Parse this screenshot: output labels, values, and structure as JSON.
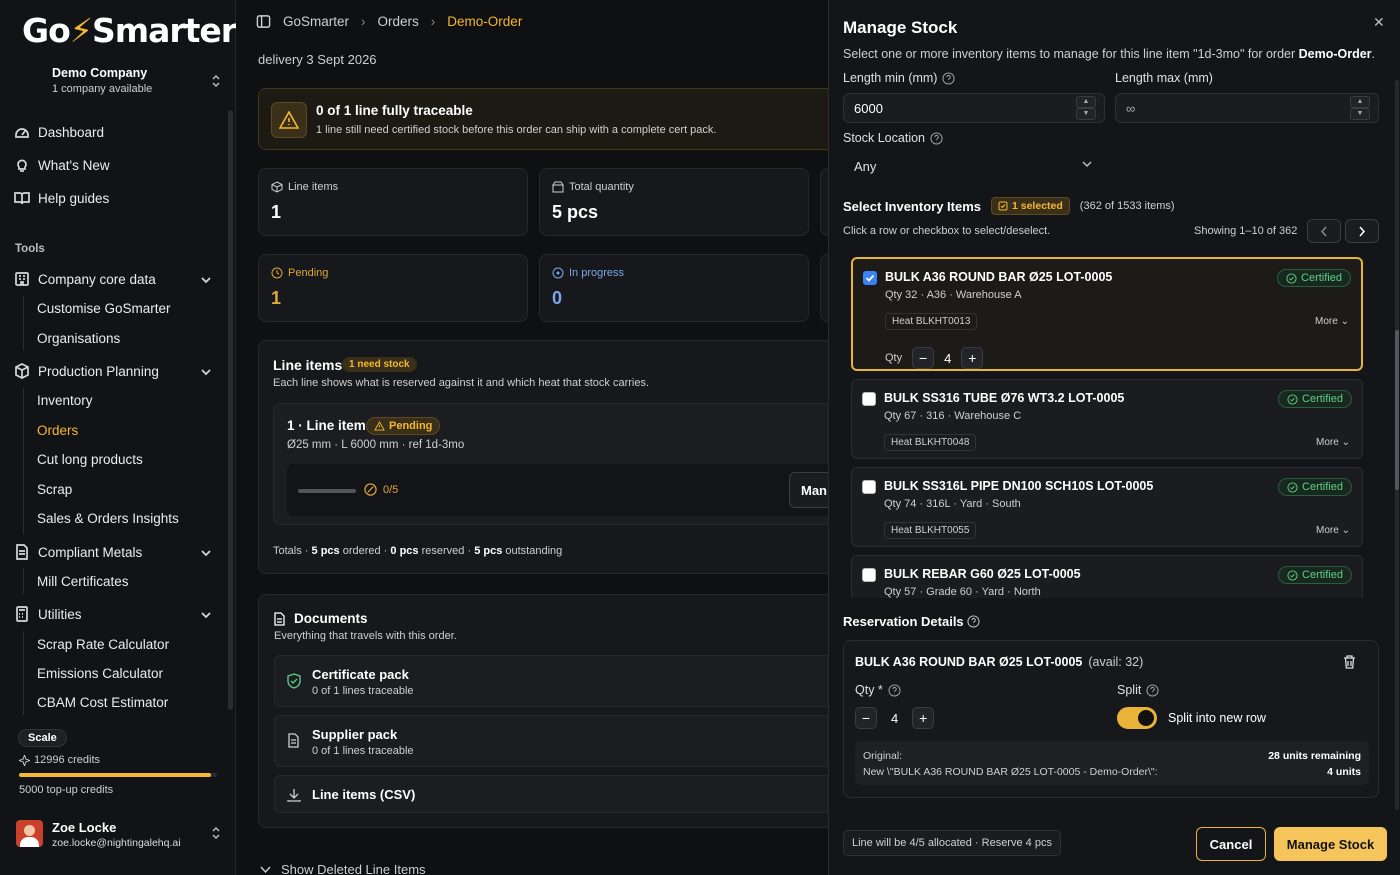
{
  "sidebar": {
    "logo": {
      "part1": "Go",
      "bolt": "⚡",
      "part2": "Smarter"
    },
    "company": {
      "name": "Demo Company",
      "sub": "1 company available"
    },
    "nav": [
      {
        "label": "Dashboard",
        "icon": "dashboard-icon"
      },
      {
        "label": "What's New",
        "icon": "lightbulb-icon"
      },
      {
        "label": "Help guides",
        "icon": "book-icon"
      }
    ],
    "tools_heading": "Tools",
    "groups": {
      "company": {
        "label": "Company core data",
        "items": [
          "Customise GoSmarter",
          "Organisations"
        ]
      },
      "production": {
        "label": "Production Planning",
        "items": [
          "Inventory",
          "Orders",
          "Cut long products",
          "Scrap",
          "Sales & Orders Insights"
        ]
      },
      "compliant": {
        "label": "Compliant Metals",
        "items": [
          "Mill Certificates"
        ]
      },
      "utilities": {
        "label": "Utilities",
        "items": [
          "Scrap Rate Calculator",
          "Emissions Calculator",
          "CBAM Cost Estimator"
        ]
      }
    },
    "active_item": "Orders",
    "plan": "Scale",
    "credits": "12996 credits",
    "credits_fraction": 0.97,
    "topup": "5000 top-up credits",
    "user": {
      "name": "Zoe Locke",
      "email": "zoe.locke@nightingalehq.ai"
    }
  },
  "main": {
    "breadcrumb": [
      "GoSmarter",
      "Orders",
      "Demo-Order"
    ],
    "delivery": "delivery 3 Sept 2026",
    "alert": {
      "title": "0 of 1 line fully traceable",
      "desc": "1 line still need certified stock before this order can ship with a complete cert pack."
    },
    "stats": {
      "line_items": {
        "label": "Line items",
        "value": "1"
      },
      "total_qty": {
        "label": "Total quantity",
        "value": "5 pcs"
      },
      "pending": {
        "label": "Pending",
        "value": "1"
      },
      "in_progress": {
        "label": "In progress",
        "value": "0"
      }
    },
    "line_items": {
      "title": "Line items",
      "badge": "1 need stock",
      "desc": "Each line shows what is reserved against it and which heat that stock carries.",
      "card": {
        "title": "1 · Line item",
        "status": "Pending",
        "meta": "Ø25 mm · L 6000 mm · ref 1d-3mo",
        "progress": "0/5",
        "manage_btn": "Man"
      },
      "totals": {
        "prefix": "Totals · ",
        "ordered_val": "5 pcs",
        "ordered_txt": " ordered · ",
        "reserved_val": "0 pcs",
        "reserved_txt": " reserved · ",
        "outstanding_val": "5 pcs",
        "outstanding_txt": " outstanding"
      }
    },
    "documents": {
      "title": "Documents",
      "desc": "Everything that travels with this order.",
      "items": [
        {
          "name": "Certificate pack",
          "sub": "0 of 1 lines traceable"
        },
        {
          "name": "Supplier pack",
          "sub": "0 of 1 lines traceable"
        },
        {
          "name": "Line items (CSV)",
          "sub": ""
        }
      ]
    },
    "show_deleted": "Show Deleted Line Items"
  },
  "panel": {
    "title": "Manage Stock",
    "close": "✕",
    "desc_prefix": "Select one or more inventory items to manage for this line item \"1d-3mo\" for order ",
    "desc_order": "Demo-Order",
    "desc_suffix": ".",
    "length_min": {
      "label": "Length min (mm)",
      "value": "6000"
    },
    "length_max": {
      "label": "Length max (mm)",
      "value": "∞"
    },
    "stock_location": {
      "label": "Stock Location",
      "value": "Any"
    },
    "select": {
      "title": "Select Inventory Items",
      "selected_badge": "1 selected",
      "count": "(362 of 1533 items)",
      "hint": "Click a row or checkbox to select/deselect.",
      "showing": "Showing 1–10 of 362"
    },
    "items": [
      {
        "name": "BULK A36 ROUND BAR Ø25 LOT-0005",
        "meta": "Qty 32 · A36 · Warehouse A",
        "cert": "Certified",
        "heat": "Heat BLKHT0013",
        "more": "More",
        "selected": true,
        "qty_label": "Qty",
        "qty": "4"
      },
      {
        "name": "BULK SS316 TUBE Ø76 WT3.2 LOT-0005",
        "meta": "Qty 67 · 316 · Warehouse C",
        "cert": "Certified",
        "heat": "Heat BLKHT0048",
        "more": "More",
        "selected": false
      },
      {
        "name": "BULK SS316L PIPE DN100 SCH10S LOT-0005",
        "meta": "Qty 74 · 316L · Yard · South",
        "cert": "Certified",
        "heat": "Heat BLKHT0055",
        "more": "More",
        "selected": false
      },
      {
        "name": "BULK REBAR G60 Ø25 LOT-0005",
        "meta": "Qty 57 · Grade 60 · Yard · North",
        "cert": "Certified",
        "heat": "",
        "more": "",
        "selected": false
      }
    ],
    "reservation": {
      "title": "Reservation Details",
      "item": "BULK A36 ROUND BAR Ø25 LOT-0005",
      "avail": "(avail: 32)",
      "qty_label": "Qty *",
      "qty": "4",
      "split_label": "Split",
      "split_toggle": "Split into new row",
      "split_on": true,
      "original_label": "Original:",
      "new_label": "New \\\"BULK A36 ROUND BAR Ø25 LOT-0005 - Demo-Order\\\":",
      "original_value": "28 units remaining",
      "new_value": "4 units"
    },
    "footer": {
      "note": "Line will be 4/5 allocated · Reserve 4 pcs",
      "cancel": "Cancel",
      "manage": "Manage Stock"
    }
  },
  "colors": {
    "accent": "#f5b731",
    "certified": "#5fcf87",
    "info": "#7aa7e8",
    "bg": "#0f1012"
  }
}
